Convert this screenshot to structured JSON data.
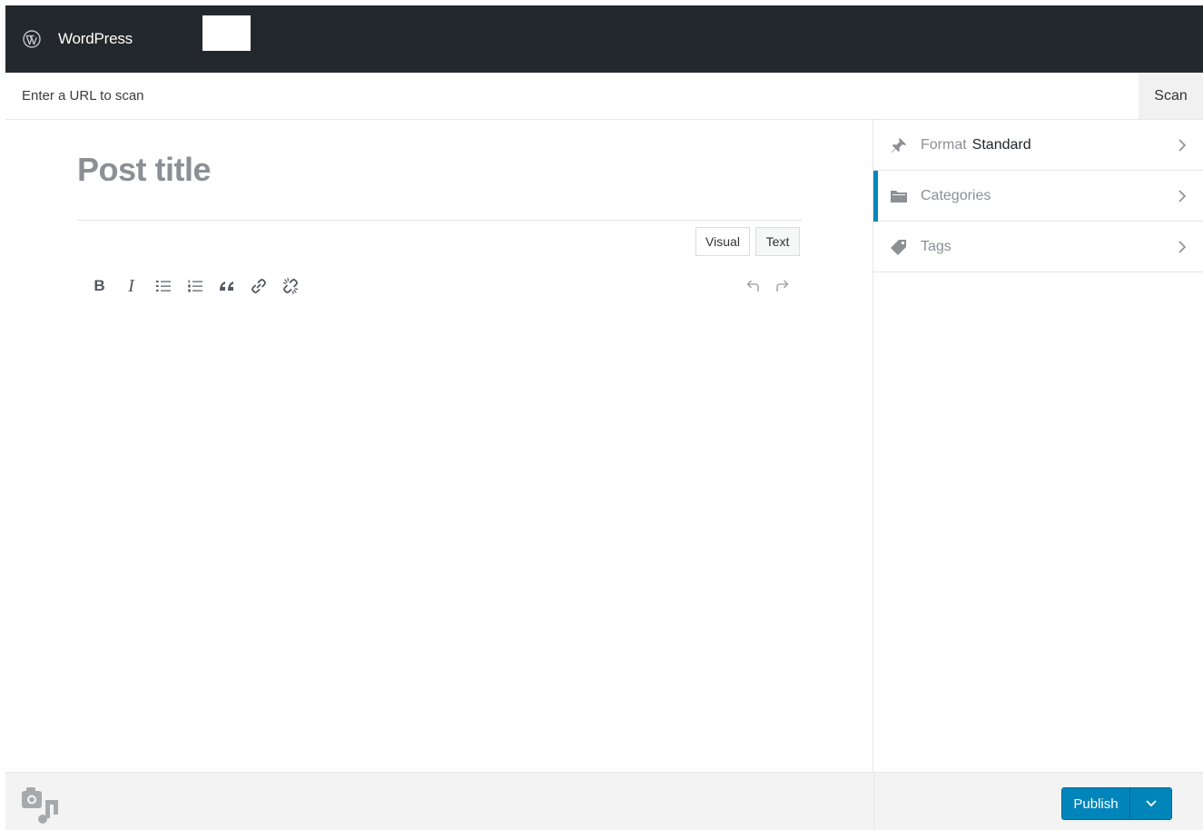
{
  "header": {
    "app_title": "WordPress"
  },
  "urlbar": {
    "placeholder": "Enter a URL to scan",
    "scan_label": "Scan"
  },
  "editor": {
    "title_placeholder": "Post title",
    "mode_visual": "Visual",
    "mode_text": "Text",
    "toolbar": {
      "bold": "B",
      "italic": "I",
      "blockquote": "“"
    }
  },
  "sidebar": {
    "items": [
      {
        "label": "Format",
        "value": "Standard",
        "icon": "pin-icon"
      },
      {
        "label": "Categories",
        "value": "",
        "icon": "folder-icon",
        "active": true
      },
      {
        "label": "Tags",
        "value": "",
        "icon": "tag-icon"
      }
    ]
  },
  "footer": {
    "publish_label": "Publish"
  },
  "colors": {
    "topbar": "#23282d",
    "accent": "#0087be",
    "publish": "#0085ba"
  }
}
